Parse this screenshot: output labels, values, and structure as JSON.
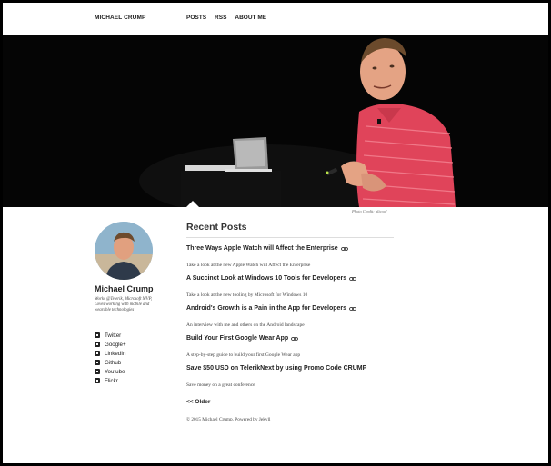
{
  "site": {
    "brand": "MICHAEL CRUMP"
  },
  "nav": {
    "items": [
      {
        "label": "POSTS"
      },
      {
        "label": "RSS"
      },
      {
        "label": "ABOUT ME"
      }
    ]
  },
  "hero": {
    "credit": "Photo Credit: alicoof"
  },
  "sidebar": {
    "name": "Michael Crump",
    "bio": "Works @Telerik, Microsoft MVP, Loves working with mobile and wearable technologies",
    "social": [
      {
        "label": "Twitter",
        "icon": "twitter-icon"
      },
      {
        "label": "Google+",
        "icon": "google-plus-icon"
      },
      {
        "label": "LinkedIn",
        "icon": "linkedin-icon"
      },
      {
        "label": "Github",
        "icon": "github-icon"
      },
      {
        "label": "Youtube",
        "icon": "youtube-icon"
      },
      {
        "label": "Flickr",
        "icon": "flickr-icon"
      }
    ]
  },
  "main": {
    "heading": "Recent Posts",
    "posts": [
      {
        "title": "Three Ways Apple Watch will Affect the Enterprise",
        "desc": "Take a look at the new Apple Watch will Affect the Enterprise",
        "has_link_icon": true
      },
      {
        "title": "A Succinct Look at Windows 10 Tools for Developers",
        "desc": "Take a look at the new tooling by Microsoft for Windows 10",
        "has_link_icon": true
      },
      {
        "title": "Android's Growth is a Pain in the App for Developers",
        "desc": "An interview with me and others on the Android landscape",
        "has_link_icon": true
      },
      {
        "title": "Build Your First Google Wear App",
        "desc": "A step-by-step guide to build your first Google Wear app",
        "has_link_icon": true
      },
      {
        "title": "Save $50 USD on TelerikNext by using Promo Code CRUMP",
        "desc": "Save money on a great conference",
        "has_link_icon": false
      }
    ],
    "older_label": "<< Older",
    "footer": "© 2015 Michael Crump. Powered by Jekyll"
  },
  "colors": {
    "shirt": "#e0445a",
    "background_dark": "#050505",
    "text": "#222222"
  }
}
